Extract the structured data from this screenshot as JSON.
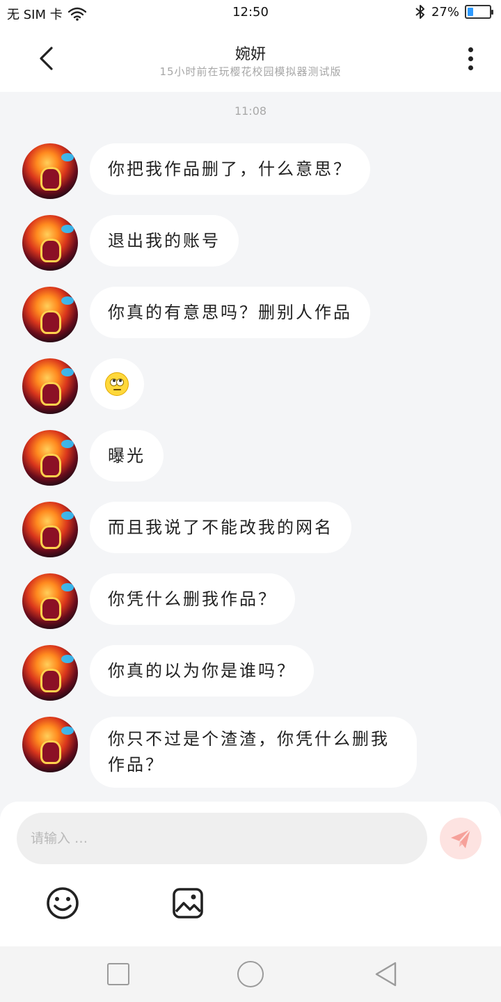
{
  "status_bar": {
    "carrier": "无 SIM 卡",
    "time": "12:50",
    "battery_percent": "27%",
    "battery_level": 0.27
  },
  "header": {
    "title": "婉妍",
    "subtitle": "15小时前在玩樱花校园模拟器测试版"
  },
  "chat": {
    "timestamp": "11:08",
    "messages": [
      {
        "type": "text",
        "text": "你把我作品删了，什么意思？"
      },
      {
        "type": "text",
        "text": "退出我的账号"
      },
      {
        "type": "text",
        "text": "你真的有意思吗？删别人作品"
      },
      {
        "type": "emoji",
        "icon": "eye-roll-emoji"
      },
      {
        "type": "text",
        "text": "曝光"
      },
      {
        "type": "text",
        "text": "而且我说了不能改我的网名"
      },
      {
        "type": "text",
        "text": "你凭什么删我作品？"
      },
      {
        "type": "text",
        "text": "你真的以为你是谁吗？"
      },
      {
        "type": "text",
        "text": "你只不过是个渣渣，你凭什么删我作品？"
      }
    ]
  },
  "composer": {
    "placeholder": "请输入 …",
    "send_icon": "paper-plane-icon",
    "send_color": "#f6a19a",
    "emoji_icon": "smiley-icon",
    "image_icon": "image-icon"
  },
  "nav_bar": {
    "icons": [
      "square-recents-icon",
      "circle-home-icon",
      "triangle-back-icon"
    ]
  }
}
